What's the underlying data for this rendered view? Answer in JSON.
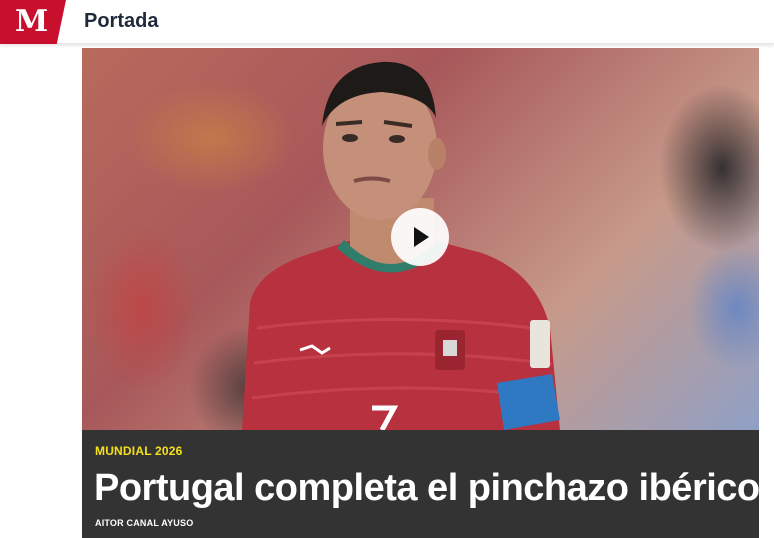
{
  "header": {
    "logo_text": "M",
    "section_title": "Portada",
    "brand_color": "#c8102e"
  },
  "media": {
    "type": "video",
    "play_icon": "play-icon"
  },
  "article": {
    "kicker": "MUNDIAL 2026",
    "headline": "Portugal completa el pinchazo ibérico",
    "author": "AITOR CANAL AYUSO",
    "kicker_color": "#f5e11a",
    "caption_bg": "#333333"
  }
}
